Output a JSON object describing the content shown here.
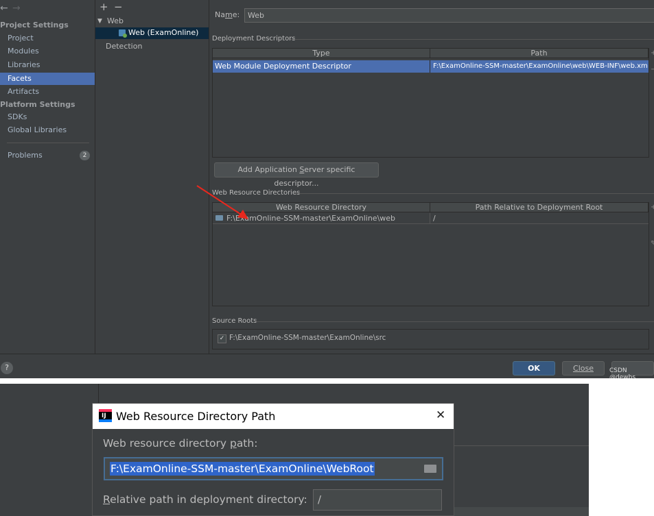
{
  "toolbar": {
    "back_icon": "←",
    "forward_icon": "→",
    "add_icon": "+",
    "remove_icon": "−"
  },
  "nav": {
    "project_settings_header": "Project Settings",
    "project": "Project",
    "modules": "Modules",
    "libraries": "Libraries",
    "facets": "Facets",
    "artifacts": "Artifacts",
    "platform_settings_header": "Platform Settings",
    "sdks": "SDKs",
    "global_libraries": "Global Libraries",
    "problems": "Problems",
    "problems_count": "2"
  },
  "facets_tree": {
    "root": "Web",
    "child": "Web (ExamOnline)",
    "detection": "Detection"
  },
  "name_field": {
    "label_pre": "Na",
    "label_u": "m",
    "label_post": "e:",
    "value": "Web"
  },
  "deployment": {
    "title": "Deployment Descriptors",
    "columns": [
      "Type",
      "Path"
    ],
    "rows": [
      {
        "type": "Web Module Deployment Descriptor",
        "path": "F:\\ExamOnline-SSM-master\\ExamOnline\\web\\WEB-INF\\web.xml"
      }
    ],
    "add_button_pre": "Add Application ",
    "add_button_u": "S",
    "add_button_post": "erver specific descriptor..."
  },
  "web_resources": {
    "title": "Web Resource Directories",
    "columns": [
      "Web Resource Directory",
      "Path Relative to Deployment Root"
    ],
    "rows": [
      {
        "dir": "F:\\ExamOnline-SSM-master\\ExamOnline\\web",
        "rel": "/"
      }
    ]
  },
  "source_roots": {
    "title": "Source Roots",
    "items": [
      {
        "checked": true,
        "path": "F:\\ExamOnline-SSM-master\\ExamOnline\\src"
      }
    ]
  },
  "buttons": {
    "ok": "OK",
    "close": "Close",
    "help_icon": "?"
  },
  "watermark": "CSDN @dewbs",
  "dialog": {
    "title": "Web Resource Directory Path",
    "close_icon": "✕",
    "path_label_pre": "Web resource directory ",
    "path_label_u": "p",
    "path_label_post": "ath:",
    "path_value": "F:\\ExamOnline-SSM-master\\ExamOnline\\WebRoot",
    "relative_label_u": "R",
    "relative_label_post": "elative path in deployment directory:",
    "relative_value": "/"
  },
  "colors": {
    "selection": "#4b6eaf",
    "ok_button": "#365880",
    "annotation_arrow": "#e8281e"
  }
}
